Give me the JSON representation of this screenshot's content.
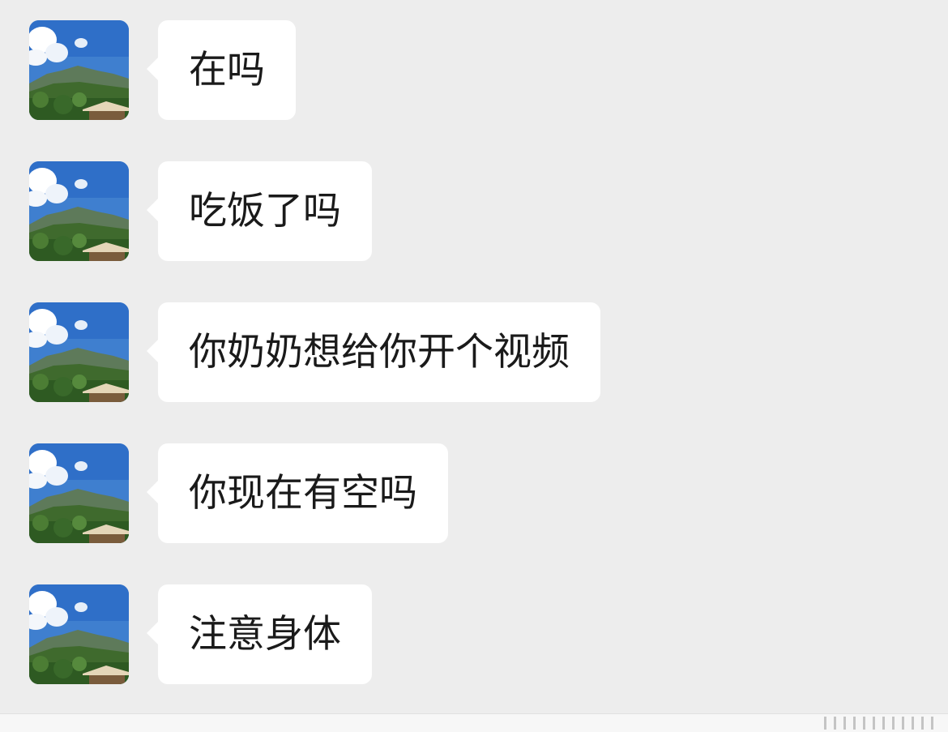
{
  "chat": {
    "messages": [
      {
        "sender": "other",
        "avatar_icon": "mountain-landscape-avatar",
        "text": "在吗"
      },
      {
        "sender": "other",
        "avatar_icon": "mountain-landscape-avatar",
        "text": "吃饭了吗"
      },
      {
        "sender": "other",
        "avatar_icon": "mountain-landscape-avatar",
        "text": "你奶奶想给你开个视频"
      },
      {
        "sender": "other",
        "avatar_icon": "mountain-landscape-avatar",
        "text": "你现在有空吗"
      },
      {
        "sender": "other",
        "avatar_icon": "mountain-landscape-avatar",
        "text": "注意身体"
      }
    ]
  },
  "colors": {
    "background": "#ededed",
    "bubble": "#ffffff",
    "text": "#1a1a1a"
  }
}
